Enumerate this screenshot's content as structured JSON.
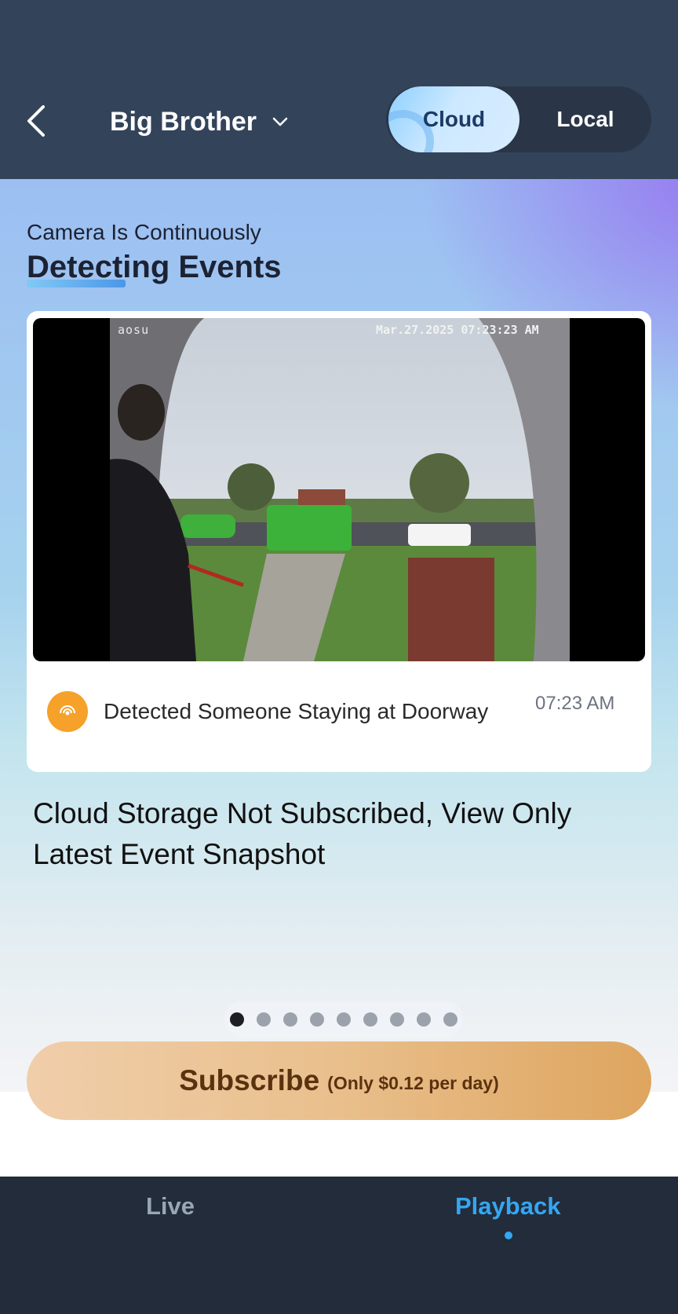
{
  "header": {
    "back_icon": "chevron-left-icon",
    "title": "Big Brother",
    "title_dropdown_icon": "chevron-down-icon",
    "segments": [
      {
        "label": "Cloud",
        "selected": true
      },
      {
        "label": "Local",
        "selected": false
      }
    ]
  },
  "hero": {
    "subtitle": "Camera Is Continuously",
    "headline": "Detecting Events"
  },
  "event": {
    "snapshot_brand": "aosu",
    "snapshot_timestamp": "Mar.27.2025 07:23:23 AM",
    "icon": "motion-sensor-icon",
    "description": "Detected Someone Staying at Doorway",
    "time": "07:23 AM"
  },
  "notice": "Cloud Storage Not Subscribed, View Only Latest Event Snapshot",
  "pagination": {
    "count": 9,
    "active_index": 0
  },
  "subscribe": {
    "label": "Subscribe",
    "price_note": "(Only $0.12 per day)"
  },
  "tabbar": {
    "tabs": [
      {
        "label": "Live",
        "selected": false
      },
      {
        "label": "Playback",
        "selected": true
      }
    ]
  },
  "colors": {
    "header_bg": "#33445a",
    "tabbar_bg": "#222c3a",
    "accent_blue": "#35a6f2",
    "event_icon": "#f6a12a",
    "subscribe_text": "#5a3210"
  }
}
